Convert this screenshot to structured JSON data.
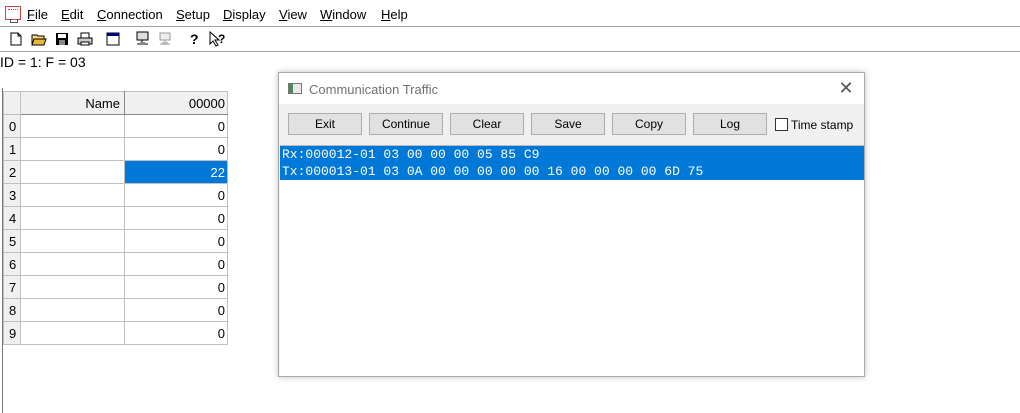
{
  "menubar": {
    "items": [
      "File",
      "Edit",
      "Connection",
      "Setup",
      "Display",
      "View",
      "Window",
      "Help"
    ],
    "underline": [
      "F",
      "E",
      "C",
      "S",
      "D",
      "V",
      "W",
      "H"
    ]
  },
  "toolbar": {
    "buttons": [
      "new-icon",
      "open-icon",
      "save-icon",
      "print-icon",
      "window-icon",
      "connect-icon",
      "disconnect-icon",
      "help-icon",
      "context-help-icon"
    ]
  },
  "statusline": "ID = 1: F = 03",
  "grid": {
    "headers": {
      "name": "Name",
      "value": "00000"
    },
    "rows": [
      {
        "index": "0",
        "name": "",
        "value": "0"
      },
      {
        "index": "1",
        "name": "",
        "value": "0"
      },
      {
        "index": "2",
        "name": "",
        "value": "22",
        "selected": true
      },
      {
        "index": "3",
        "name": "",
        "value": "0"
      },
      {
        "index": "4",
        "name": "",
        "value": "0"
      },
      {
        "index": "5",
        "name": "",
        "value": "0"
      },
      {
        "index": "6",
        "name": "",
        "value": "0"
      },
      {
        "index": "7",
        "name": "",
        "value": "0"
      },
      {
        "index": "8",
        "name": "",
        "value": "0"
      },
      {
        "index": "9",
        "name": "",
        "value": "0"
      }
    ]
  },
  "dialog": {
    "title": "Communication Traffic",
    "buttons": {
      "exit": "Exit",
      "continue": "Continue",
      "clear": "Clear",
      "save": "Save",
      "copy": "Copy",
      "log": "Log"
    },
    "timestamp_label": "Time stamp",
    "timestamp_checked": false,
    "lines": [
      "Rx:000012-01 03 00 00 00 05 85 C9",
      "Tx:000013-01 03 0A 00 00 00 00 00 16 00 00 00 00 6D 75"
    ]
  },
  "colors": {
    "selection": "#0078d7"
  }
}
